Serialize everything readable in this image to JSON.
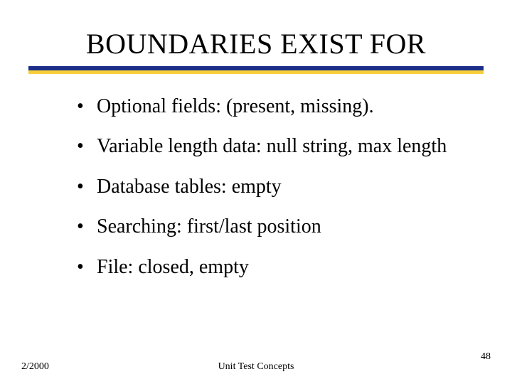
{
  "slide": {
    "title": "BOUNDARIES EXIST FOR",
    "bullets": [
      "Optional fields: (present, missing).",
      "Variable length data: null string, max length",
      "Database tables: empty",
      "Searching: first/last position",
      "File: closed, empty"
    ],
    "footer": {
      "date": "2/2000",
      "center": "Unit Test Concepts",
      "page": "48"
    }
  }
}
